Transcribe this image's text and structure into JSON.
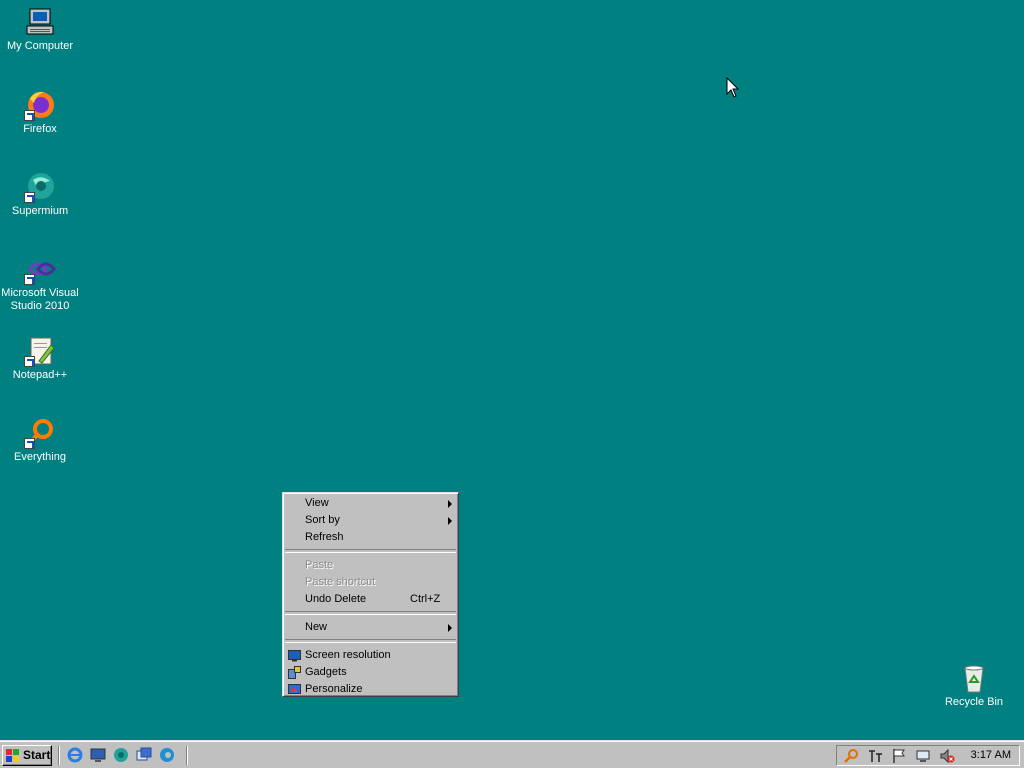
{
  "desktop": {
    "icons": [
      {
        "label": "My Computer",
        "icon": "my-computer-icon"
      },
      {
        "label": "Firefox",
        "icon": "firefox-icon"
      },
      {
        "label": "Supermium",
        "icon": "supermium-icon"
      },
      {
        "label": "Microsoft Visual Studio 2010",
        "icon": "visual-studio-icon"
      },
      {
        "label": "Notepad++",
        "icon": "notepad-plus-plus-icon"
      },
      {
        "label": "Everything",
        "icon": "everything-search-icon"
      },
      {
        "label": "Recycle Bin",
        "icon": "recycle-bin-icon"
      }
    ]
  },
  "context_menu": {
    "items": [
      {
        "label": "View",
        "submenu": true
      },
      {
        "label": "Sort by",
        "submenu": true
      },
      {
        "label": "Refresh"
      },
      {
        "label": "Paste",
        "disabled": true
      },
      {
        "label": "Paste shortcut",
        "disabled": true
      },
      {
        "label": "Undo Delete",
        "shortcut": "Ctrl+Z"
      },
      {
        "label": "New",
        "submenu": true
      },
      {
        "label": "Screen resolution",
        "icon": "screen-resolution-icon"
      },
      {
        "label": "Gadgets",
        "icon": "gadgets-icon"
      },
      {
        "label": "Personalize",
        "icon": "personalize-icon"
      }
    ]
  },
  "taskbar": {
    "start_label": "Start",
    "quick_launch": [
      "internet-explorer-icon",
      "show-desktop-icon",
      "supermium-icon",
      "switch-windows-icon",
      "edge-icon"
    ],
    "tray_icons": [
      "search-icon",
      "input-method-icon",
      "action-center-flag-icon",
      "network-icon",
      "volume-muted-icon"
    ],
    "clock": "3:17 AM"
  },
  "colors": {
    "desktop_background": "#008080",
    "chrome_face": "#c0c0c0"
  }
}
